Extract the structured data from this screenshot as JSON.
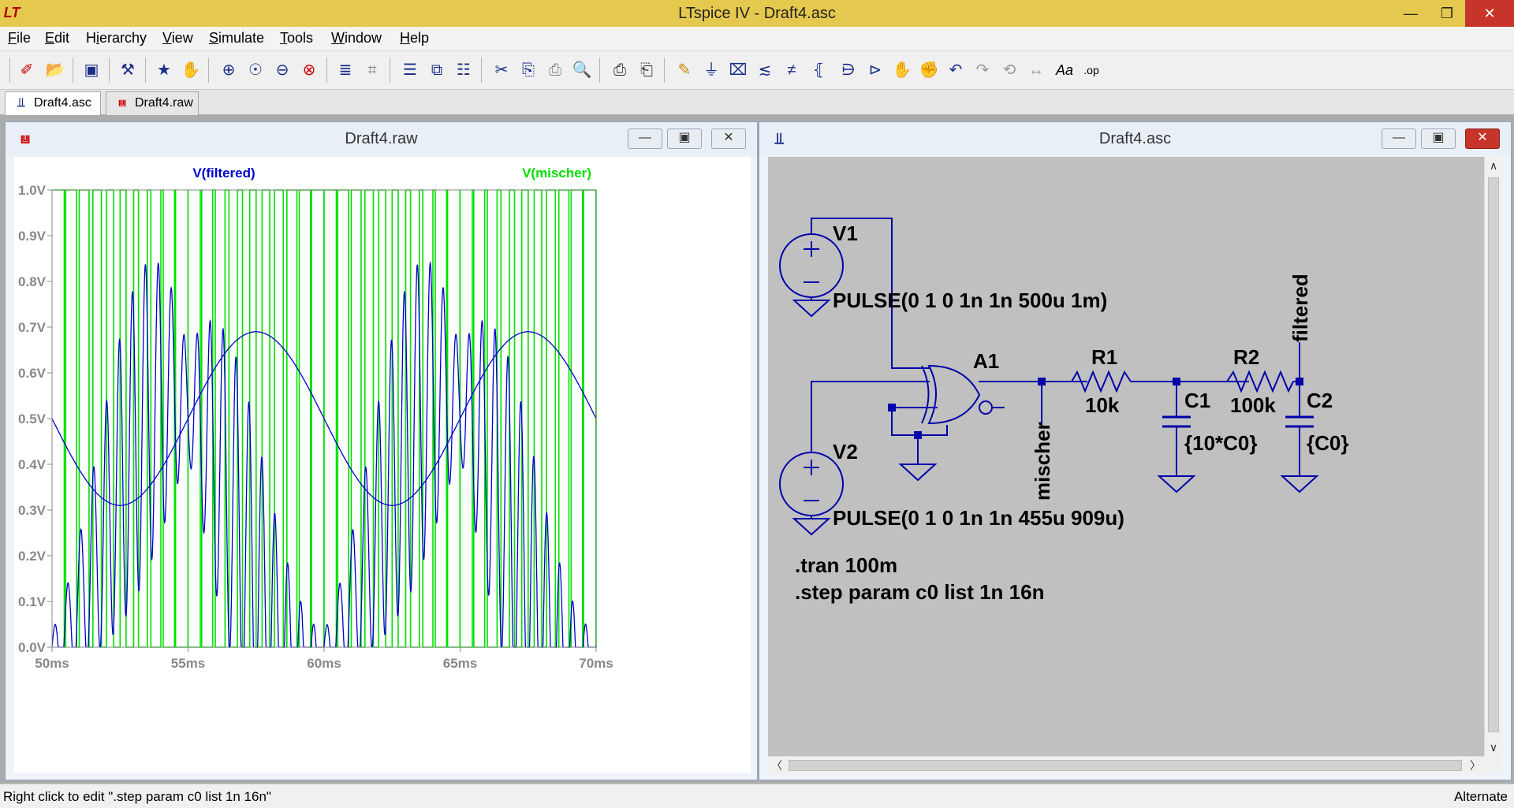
{
  "window": {
    "title": "LTspice IV - Draft4.asc",
    "minimize": "—",
    "restore": "❐",
    "close": "✕"
  },
  "menu": [
    "File",
    "Edit",
    "Hierarchy",
    "View",
    "Simulate",
    "Tools",
    "Window",
    "Help"
  ],
  "menu_underline": [
    "F",
    "E",
    "i",
    "V",
    "S",
    "T",
    "W",
    "H"
  ],
  "toolbar_icons": [
    "new-schematic-icon",
    "open-icon",
    "save-icon",
    "control-panel-icon",
    "run-icon",
    "halt-icon",
    "zoom-in-icon",
    "zoom-pan-icon",
    "zoom-out-icon",
    "zoom-cancel-icon",
    "autorange-icon",
    "grid-icon",
    "tile-horizontal-icon",
    "cascade-icon",
    "tile-vertical-icon",
    "cut-icon",
    "copy-icon",
    "paste-icon",
    "find-icon",
    "print-preview-icon",
    "print-icon",
    "wire-icon",
    "ground-icon",
    "label-icon",
    "resistor-icon",
    "capacitor-icon",
    "inductor-icon",
    "diode-icon",
    "component-icon",
    "move-icon",
    "drag-icon",
    "undo-icon",
    "redo-icon",
    "rotate-icon",
    "mirror-icon",
    "text-icon",
    "spice-directive-icon"
  ],
  "tabs": [
    {
      "label": "Draft4.asc",
      "icon": "schematic-icon"
    },
    {
      "label": "Draft4.raw",
      "icon": "waveform-icon"
    }
  ],
  "waveform_window": {
    "title": "Draft4.raw"
  },
  "schematic_window": {
    "title": "Draft4.asc"
  },
  "chart_data": {
    "type": "line",
    "title": "",
    "xlabel": "",
    "ylabel": "",
    "xlim": [
      50,
      70
    ],
    "ylim": [
      0,
      1.0
    ],
    "x_ticks": [
      "50ms",
      "55ms",
      "60ms",
      "65ms",
      "70ms"
    ],
    "y_ticks": [
      "0.0V",
      "0.1V",
      "0.2V",
      "0.3V",
      "0.4V",
      "0.5V",
      "0.6V",
      "0.7V",
      "0.8V",
      "0.9V",
      "1.0V"
    ],
    "legend_placement": "top",
    "grid": false,
    "series": [
      {
        "name": "V(filtered)",
        "color": "#0000cc",
        "description_x_ms": [
          50,
          51.5,
          53,
          57.25,
          60,
          62,
          67.25,
          70
        ],
        "values_smooth": [
          0.5,
          0.35,
          0.31,
          0.69,
          0.51,
          0.31,
          0.69,
          0.5
        ]
      },
      {
        "name": "V(mischer)",
        "color": "#00e000",
        "levels": [
          0,
          1
        ]
      }
    ],
    "filtered_fast_envelope": {
      "x_ms": [
        50,
        52.5,
        55,
        57.5,
        60,
        62.5,
        65,
        67.5,
        70
      ],
      "peak_to_peak_max": [
        0.05,
        0.6,
        1.0,
        0.6,
        0.05,
        0.6,
        1.0,
        0.6,
        0.05
      ]
    }
  },
  "schematic": {
    "labels": {
      "v1": "V1",
      "v1_value": "PULSE(0 1 0 1n 1n 500u 1m)",
      "v2": "V2",
      "v2_value": "PULSE(0 1 0 1n 1n 455u 909u)",
      "a1": "A1",
      "r1": "R1",
      "r1_value": "10k",
      "r2": "R2",
      "r2_value": "100k",
      "c1": "C1",
      "c1_value": "{10*C0}",
      "c2": "C2",
      "c2_value": "{C0}",
      "net_mischer": "mischer",
      "net_filtered": "filtered",
      "directive_tran": ".tran 100m",
      "directive_step": ".step param c0 list 1n 16n"
    },
    "wire_color": "#0000aa"
  },
  "status": {
    "hint": "Right click to edit \".step param c0 list 1n 16n\"",
    "mode": "Alternate"
  }
}
